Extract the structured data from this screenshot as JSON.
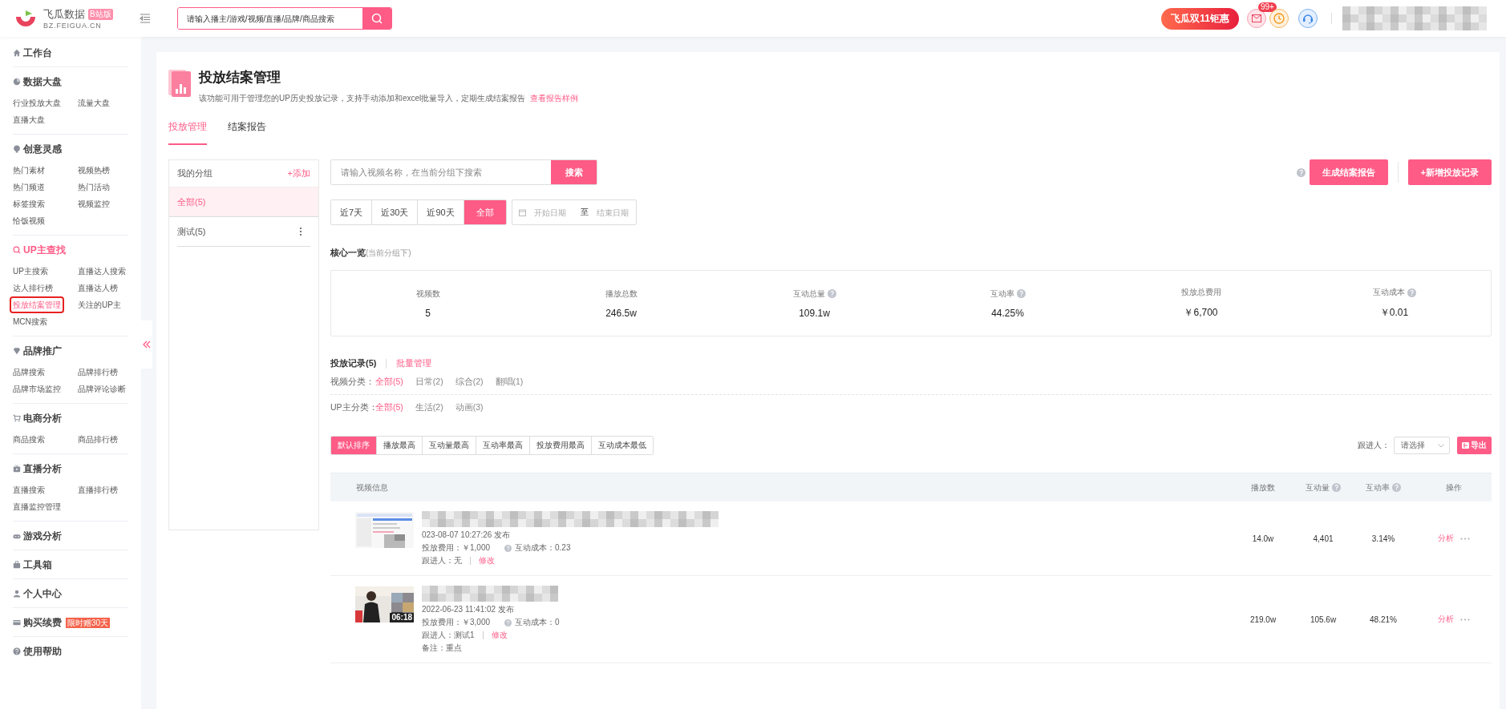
{
  "header": {
    "logo_name": "飞瓜数据",
    "logo_badge": "B站版",
    "logo_domain": "BZ.FEIGUA.CN",
    "search_placeholder": "请输入播主/游戏/视频/直播/品牌/商品搜索",
    "promo": "飞瓜双11钜惠",
    "mail_badge": "99+"
  },
  "sidebar": {
    "sections": [
      {
        "title": "工作台",
        "selected": false
      },
      {
        "title": "数据大盘",
        "selected": false,
        "items": [
          {
            "label": "行业投放大盘",
            "selected": false
          },
          {
            "label": "流量大盘",
            "selected": false
          },
          {
            "label": "直播大盘",
            "selected": false
          }
        ]
      },
      {
        "title": "创意灵感",
        "selected": false,
        "items": [
          {
            "label": "热门素材",
            "selected": false
          },
          {
            "label": "视频热榜",
            "selected": false
          },
          {
            "label": "热门频道",
            "selected": false
          },
          {
            "label": "热门活动",
            "selected": false
          },
          {
            "label": "标签搜索",
            "selected": false
          },
          {
            "label": "视频监控",
            "selected": false
          },
          {
            "label": "恰饭视频",
            "selected": false
          }
        ]
      },
      {
        "title": "UP主查找",
        "selected": true,
        "items": [
          {
            "label": "UP主搜索",
            "selected": false
          },
          {
            "label": "直播达人搜索",
            "selected": false
          },
          {
            "label": "达人排行榜",
            "selected": false
          },
          {
            "label": "直播达人榜",
            "selected": false
          },
          {
            "label": "投放结案管理",
            "selected": true
          },
          {
            "label": "关注的UP主",
            "selected": false
          },
          {
            "label": "MCN搜索",
            "selected": false
          }
        ]
      },
      {
        "title": "品牌推广",
        "selected": false,
        "items": [
          {
            "label": "品牌搜索",
            "selected": false
          },
          {
            "label": "品牌排行榜",
            "selected": false
          },
          {
            "label": "品牌市场监控",
            "selected": false
          },
          {
            "label": "品牌评论诊断",
            "selected": false
          }
        ]
      },
      {
        "title": "电商分析",
        "selected": false,
        "items": [
          {
            "label": "商品搜索",
            "selected": false
          },
          {
            "label": "商品排行榜",
            "selected": false
          }
        ]
      },
      {
        "title": "直播分析",
        "selected": false,
        "items": [
          {
            "label": "直播搜索",
            "selected": false
          },
          {
            "label": "直播排行榜",
            "selected": false
          },
          {
            "label": "直播监控管理",
            "selected": false
          }
        ]
      },
      {
        "title": "游戏分析",
        "selected": false
      },
      {
        "title": "工具箱",
        "selected": false
      },
      {
        "title": "个人中心",
        "selected": false
      },
      {
        "title": "购买续费",
        "selected": false,
        "badge": "限时赠30天"
      },
      {
        "title": "使用帮助",
        "selected": false
      }
    ]
  },
  "page": {
    "title": "投放结案管理",
    "description": "该功能可用于管理您的UP历史投放记录，支持手动添加和excel批量导入，定期生成结案报告",
    "sample_link": "查看报告样例",
    "tabs": [
      {
        "label": "投放管理",
        "selected": true
      },
      {
        "label": "结案报告",
        "selected": false
      }
    ],
    "groups": {
      "title": "我的分组",
      "add": "+添加",
      "items": [
        {
          "label": "全部(5)",
          "selected": true,
          "has_menu": false
        },
        {
          "label": "测试(5)",
          "selected": false,
          "has_menu": true
        }
      ]
    },
    "search": {
      "placeholder": "请输入视频名称，在当前分组下搜索",
      "button": "搜索"
    },
    "actions": [
      "生成结案报告",
      "+新增投放记录"
    ],
    "periods": [
      {
        "label": "近7天",
        "selected": false
      },
      {
        "label": "近30天",
        "selected": false
      },
      {
        "label": "近90天",
        "selected": false
      },
      {
        "label": "全部",
        "selected": true
      }
    ],
    "date_range": {
      "start_placeholder": "开始日期",
      "separator": "至",
      "end_placeholder": "结束日期"
    },
    "summary": {
      "title": "核心一览",
      "subtitle": "(当前分组下)",
      "metrics": [
        {
          "label": "视频数",
          "value": "5",
          "help": false
        },
        {
          "label": "播放总数",
          "value": "246.5w",
          "help": false
        },
        {
          "label": "互动总量",
          "value": "109.1w",
          "help": true
        },
        {
          "label": "互动率",
          "value": "44.25%",
          "help": true
        },
        {
          "label": "投放总费用",
          "value": "￥6,700",
          "help": false
        },
        {
          "label": "互动成本",
          "value": "￥0.01",
          "help": true
        }
      ]
    },
    "records": {
      "title": "投放记录(5)",
      "batch": "批量管理"
    },
    "filters": [
      {
        "label": "视频分类：",
        "options": [
          {
            "label": "全部(5)",
            "selected": true
          },
          {
            "label": "日常(2)",
            "selected": false
          },
          {
            "label": "综合(2)",
            "selected": false
          },
          {
            "label": "翻唱(1)",
            "selected": false
          }
        ]
      },
      {
        "label": "UP主分类：",
        "options": [
          {
            "label": "全部(5)",
            "selected": true
          },
          {
            "label": "生活(2)",
            "selected": false
          },
          {
            "label": "动画(3)",
            "selected": false
          }
        ]
      }
    ],
    "sorts": [
      {
        "label": "默认排序",
        "selected": true
      },
      {
        "label": "播放最高",
        "selected": false
      },
      {
        "label": "互动量最高",
        "selected": false
      },
      {
        "label": "互动率最高",
        "selected": false
      },
      {
        "label": "投放费用最高",
        "selected": false
      },
      {
        "label": "互动成本最低",
        "selected": false
      }
    ],
    "follower": {
      "label": "跟进人：",
      "placeholder": "请选择"
    },
    "export": "导出",
    "table": {
      "columns": [
        {
          "label": "视频信息",
          "help": false
        },
        {
          "label": "播放数",
          "help": false
        },
        {
          "label": "互动量",
          "help": true
        },
        {
          "label": "互动率",
          "help": true
        },
        {
          "label": "操作",
          "help": false
        }
      ],
      "rows": [
        {
          "published": "023-08-07 10:27:26 发布",
          "cost": "投放费用：￥1,000",
          "cost_rate": "互动成本：0.23",
          "follower": "跟进人：无",
          "edit": "修改",
          "plays": "14.0w",
          "interactions": "4,401",
          "rate": "3.14%",
          "action": "分析"
        },
        {
          "duration": "06:18",
          "published": "2022-06-23 11:41:02 发布",
          "cost": "投放费用：￥3,000",
          "cost_rate": "互动成本：0",
          "follower": "跟进人：测试1",
          "edit": "修改",
          "note": "备注：重点",
          "plays": "219.0w",
          "interactions": "105.6w",
          "rate": "48.21%",
          "action": "分析"
        }
      ]
    }
  }
}
